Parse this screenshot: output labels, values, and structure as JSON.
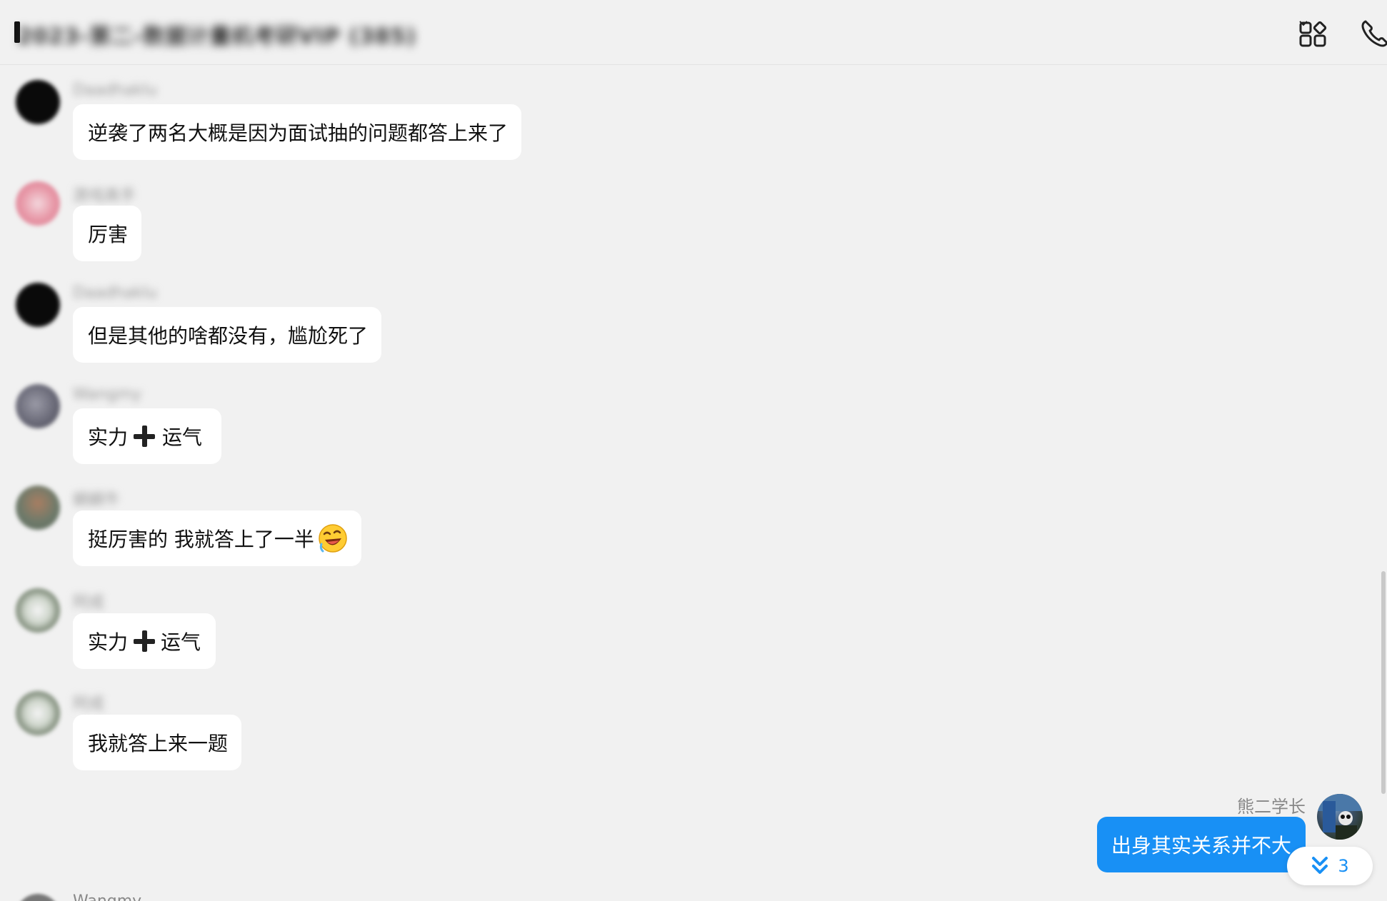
{
  "header": {
    "title": "2023-第二-数据计量机考研VIP (385)"
  },
  "messages": [
    {
      "sender": "Daadhaklu",
      "text": "逆袭了两名大概是因为面试抽的问题都答上来了"
    },
    {
      "sender": "游戏高手",
      "text": "厉害"
    },
    {
      "sender": "Daadhaklu",
      "text": "但是其他的啥都没有，尴尬死了"
    },
    {
      "sender": "Wangmy",
      "text_before": "实力",
      "icon": "heavy-plus-icon",
      "text_after": "运气"
    },
    {
      "sender": "蜗蜗牛",
      "text": "挺厉害的 我就答上了一半",
      "emoji": "laughing-crying-emoji"
    },
    {
      "sender": "阿成",
      "text_before": "实力",
      "icon": "heavy-plus-icon",
      "text_after": "运气"
    },
    {
      "sender": "阿成",
      "text": "我就答上来一题"
    }
  ],
  "own_message": {
    "sender": "熊二学长",
    "text": "出身其实关系并不大"
  },
  "unread_badge": {
    "count": "3"
  },
  "partial_message": {
    "sender": "Wangmy"
  },
  "colors": {
    "background": "#f1f1f1",
    "bubble": "#ffffff",
    "own_bubble": "#1890f5",
    "accent": "#1890f5"
  }
}
